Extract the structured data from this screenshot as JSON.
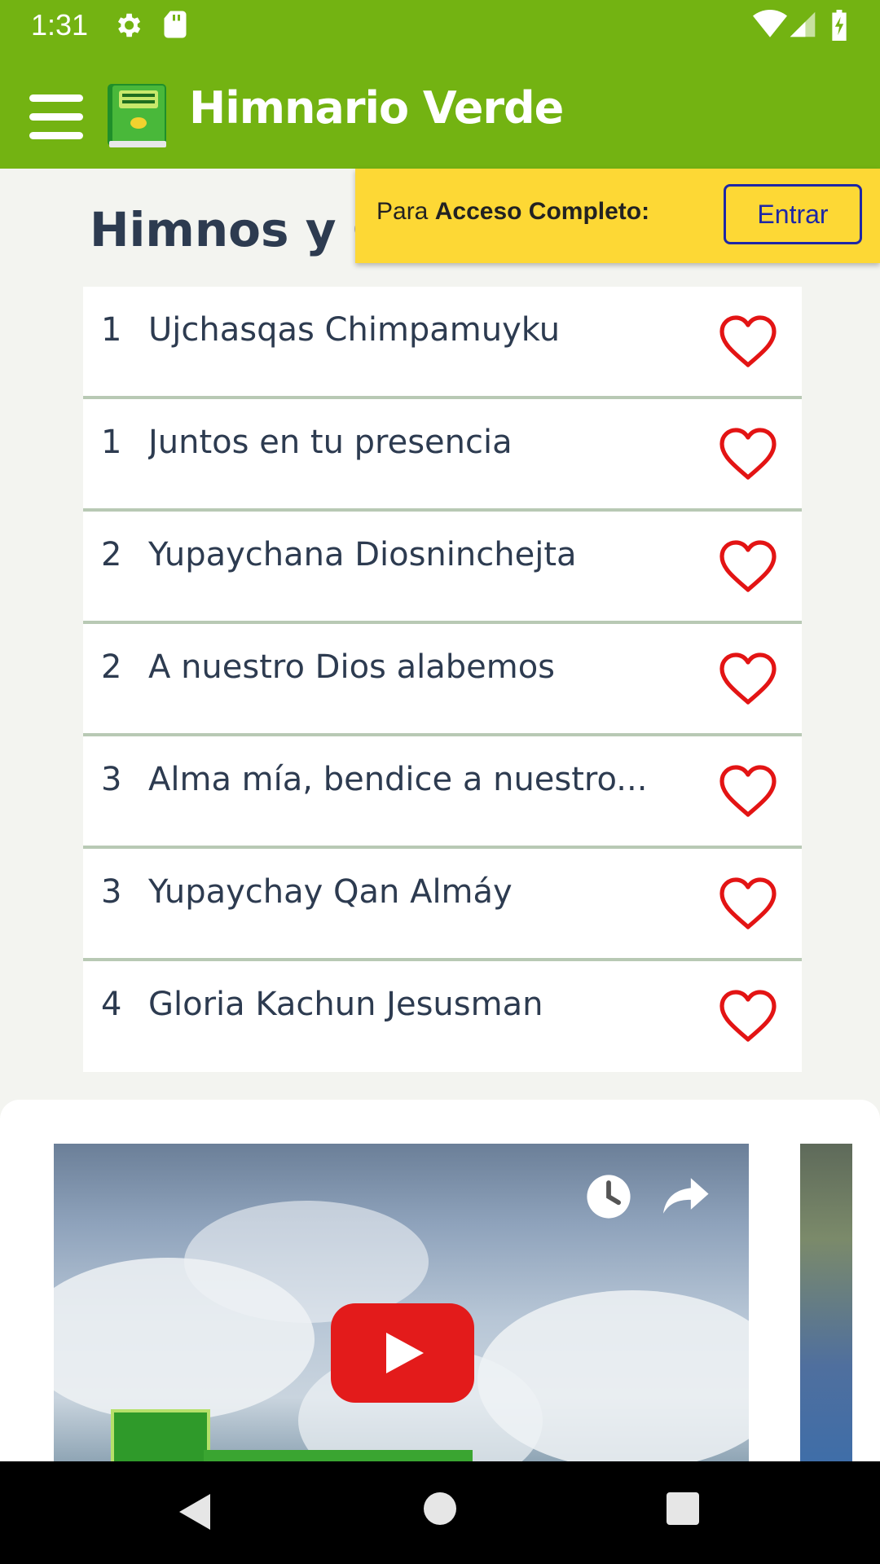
{
  "status_bar": {
    "time": "1:31",
    "icons": [
      "settings-icon",
      "sd-card-icon",
      "wifi-icon",
      "signal-icon",
      "battery-icon"
    ]
  },
  "app_bar": {
    "title": "Himnario Verde",
    "menu_icon": "hamburger-menu-icon",
    "logo_icon": "book-logo-icon",
    "background_color": "#73b312"
  },
  "section": {
    "title": "Himnos y Coros"
  },
  "access_banner": {
    "prefix": "Para ",
    "bold_text": "Acceso Completo:",
    "button_label": "Entrar",
    "background_color": "#fdd835",
    "button_color": "#1d27a6"
  },
  "hymns": [
    {
      "number": "1",
      "title": "Ujchasqas Chimpamuyku"
    },
    {
      "number": "1",
      "title": "Juntos en tu presencia"
    },
    {
      "number": "2",
      "title": "Yupaychana Diosninchejta"
    },
    {
      "number": "2",
      "title": "A nuestro Dios alabemos"
    },
    {
      "number": "3",
      "title": "Alma mía, bendice a nuestro..."
    },
    {
      "number": "3",
      "title": "Yupaychay Qan Almáy"
    },
    {
      "number": "4",
      "title": "Gloria Kachun Jesusman"
    }
  ],
  "favorite_icon": "heart-outline-icon",
  "favorite_color": "#e31414",
  "video": {
    "icons": [
      "watch-later-icon",
      "share-icon",
      "youtube-play-icon"
    ]
  },
  "nav_bar": {
    "icons": [
      "back-icon",
      "home-icon",
      "recents-icon"
    ]
  }
}
